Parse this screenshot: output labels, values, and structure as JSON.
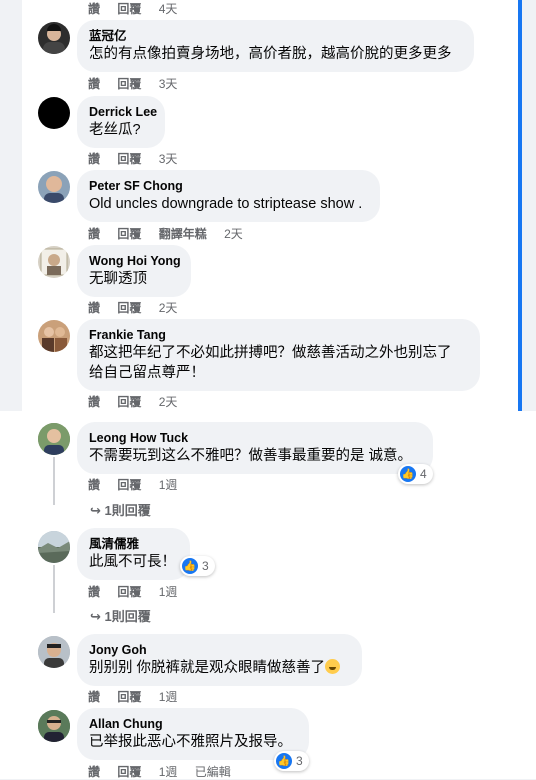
{
  "colors": {
    "like_blue": "#1877f2",
    "meta_grey": "#65676b",
    "bubble_bg": "#f0f2f5"
  },
  "actions": {
    "like": "讚",
    "reply": "回覆",
    "translate": "翻譯年糕",
    "edited": "已編輯"
  },
  "comments": [
    {
      "author": "",
      "text": "",
      "time": "4天"
    },
    {
      "author": "蓝冠亿",
      "text": "怎的有点像拍賣身场地，高价者脫，越高价脫的更多更多",
      "time": "3天"
    },
    {
      "author": "Derrick Lee",
      "text": "老丝瓜?",
      "time": "3天"
    },
    {
      "author": "Peter SF Chong",
      "text": "Old uncles downgrade to striptease show .",
      "time": "2天"
    },
    {
      "author": "Wong Hoi Yong",
      "text": "无聊透顶",
      "time": "2天"
    },
    {
      "author": "Frankie Tang",
      "text_line1": "都这把年纪了不必如此拼搏吧？做慈善活动之外也别忘了",
      "text_line2": "给自己留点尊严！",
      "time": "2天"
    },
    {
      "author": "Leong How Tuck",
      "text": "不需要玩到这么不雅吧？做善事最重要的是 诚意。",
      "time": "1週",
      "reactions": "4",
      "replies": "1則回覆"
    },
    {
      "author": "風清儒雅",
      "text": "此風不可長！",
      "time": "1週",
      "reactions": "3",
      "replies": "1則回覆"
    },
    {
      "author": "Jony Goh",
      "text": "别别别 你脱裤就是观众眼睛做慈善了",
      "time": "1週"
    },
    {
      "author": "Allan Chung",
      "text": "已举报此恶心不雅照片及报导。",
      "time": "1週",
      "reactions": "3"
    }
  ],
  "icons": {
    "like": "thumbs-up-icon",
    "reply_arrow": "reply-arrow-icon",
    "emoji": "grinning-squinting-face-emoji"
  }
}
